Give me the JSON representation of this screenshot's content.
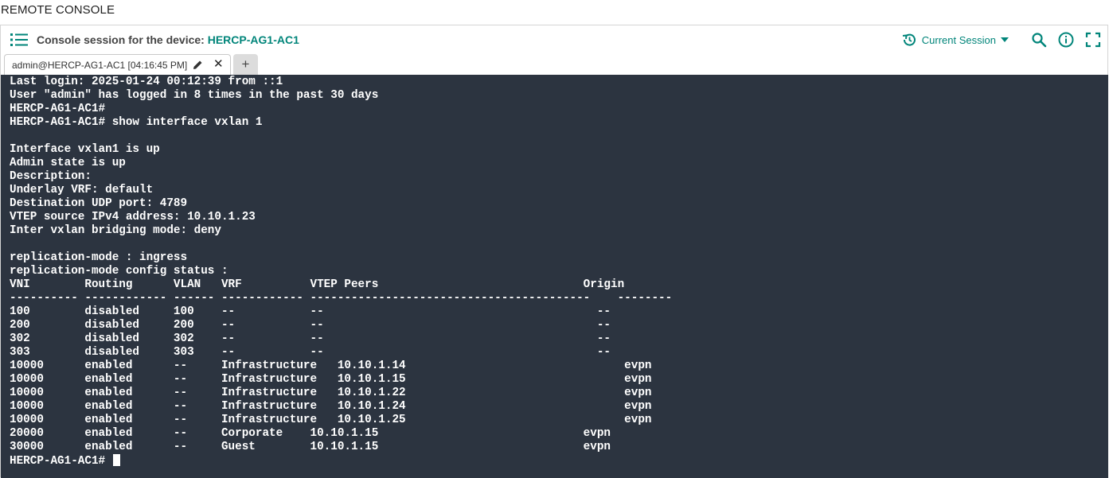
{
  "page": {
    "title": "REMOTE CONSOLE"
  },
  "header": {
    "session_prefix": "Console session for the device: ",
    "device_name": "HERCP-AG1-AC1",
    "current_session_label": "Current Session"
  },
  "tabs": [
    {
      "label": "admin@HERCP-AG1-AC1 [04:16:45 PM]"
    }
  ],
  "icons": {
    "menu": "list-icon",
    "history": "history-icon",
    "search": "search-icon",
    "info": "info-icon",
    "fullscreen": "fullscreen-icon",
    "edit": "pencil-icon",
    "close": "close-icon",
    "add": "plus-icon"
  },
  "colors": {
    "accent": "#01857a",
    "terminal_bg": "#2c3440",
    "terminal_fg": "#ffffff"
  },
  "terminal": {
    "lines": [
      "Last login: 2025-01-24 00:12:39 from ::1",
      "User \"admin\" has logged in 8 times in the past 30 days",
      "HERCP-AG1-AC1#",
      "HERCP-AG1-AC1# show interface vxlan 1",
      "",
      "Interface vxlan1 is up",
      "Admin state is up",
      "Description:",
      "Underlay VRF: default",
      "Destination UDP port: 4789",
      "VTEP source IPv4 address: 10.10.1.23",
      "Inter vxlan bridging mode: deny",
      "",
      "replication-mode : ingress",
      "replication-mode config status :",
      "VNI        Routing      VLAN   VRF          VTEP Peers                              Origin",
      "---------- ------------ ------ ------------ -----------------------------------------    --------",
      "100        disabled     100    --           --                                        --",
      "200        disabled     200    --           --                                        --",
      "302        disabled     302    --           --                                        --",
      "303        disabled     303    --           --                                        --",
      "10000      enabled      --     Infrastructure   10.10.1.14                                evpn",
      "10000      enabled      --     Infrastructure   10.10.1.15                                evpn",
      "10000      enabled      --     Infrastructure   10.10.1.22                                evpn",
      "10000      enabled      --     Infrastructure   10.10.1.24                                evpn",
      "10000      enabled      --     Infrastructure   10.10.1.25                                evpn",
      "20000      enabled      --     Corporate    10.10.1.15                              evpn",
      "30000      enabled      --     Guest        10.10.1.15                              evpn"
    ],
    "prompt": "HERCP-AG1-AC1# "
  }
}
